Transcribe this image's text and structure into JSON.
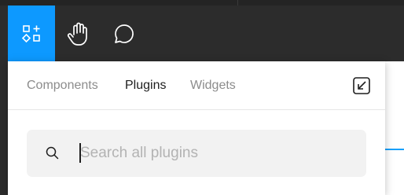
{
  "toolbar": {
    "tools": [
      {
        "name": "components-icon",
        "active": true
      },
      {
        "name": "hand-icon",
        "active": false
      },
      {
        "name": "comment-icon",
        "active": false
      }
    ],
    "accent": "#0d99ff"
  },
  "panel": {
    "tabs": [
      {
        "label": "Components",
        "active": false
      },
      {
        "label": "Plugins",
        "active": true
      },
      {
        "label": "Widgets",
        "active": false
      }
    ],
    "collapse_icon": "collapse-arrow-icon",
    "search": {
      "placeholder": "Search all plugins",
      "value": ""
    }
  }
}
